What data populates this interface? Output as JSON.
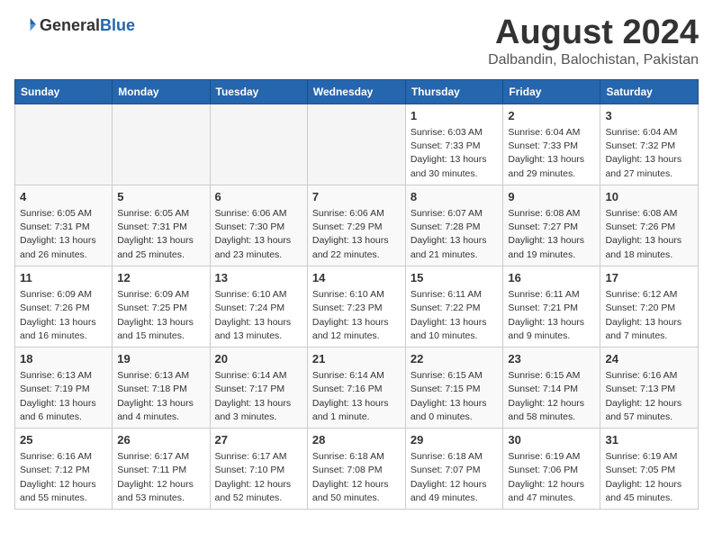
{
  "header": {
    "logo_general": "General",
    "logo_blue": "Blue",
    "month_title": "August 2024",
    "subtitle": "Dalbandin, Balochistan, Pakistan"
  },
  "weekdays": [
    "Sunday",
    "Monday",
    "Tuesday",
    "Wednesday",
    "Thursday",
    "Friday",
    "Saturday"
  ],
  "weeks": [
    [
      {
        "day": "",
        "sunrise": "",
        "sunset": "",
        "daylight": "",
        "empty": true
      },
      {
        "day": "",
        "sunrise": "",
        "sunset": "",
        "daylight": "",
        "empty": true
      },
      {
        "day": "",
        "sunrise": "",
        "sunset": "",
        "daylight": "",
        "empty": true
      },
      {
        "day": "",
        "sunrise": "",
        "sunset": "",
        "daylight": "",
        "empty": true
      },
      {
        "day": "1",
        "sunrise": "Sunrise: 6:03 AM",
        "sunset": "Sunset: 7:33 PM",
        "daylight": "Daylight: 13 hours and 30 minutes.",
        "empty": false
      },
      {
        "day": "2",
        "sunrise": "Sunrise: 6:04 AM",
        "sunset": "Sunset: 7:33 PM",
        "daylight": "Daylight: 13 hours and 29 minutes.",
        "empty": false
      },
      {
        "day": "3",
        "sunrise": "Sunrise: 6:04 AM",
        "sunset": "Sunset: 7:32 PM",
        "daylight": "Daylight: 13 hours and 27 minutes.",
        "empty": false
      }
    ],
    [
      {
        "day": "4",
        "sunrise": "Sunrise: 6:05 AM",
        "sunset": "Sunset: 7:31 PM",
        "daylight": "Daylight: 13 hours and 26 minutes.",
        "empty": false
      },
      {
        "day": "5",
        "sunrise": "Sunrise: 6:05 AM",
        "sunset": "Sunset: 7:31 PM",
        "daylight": "Daylight: 13 hours and 25 minutes.",
        "empty": false
      },
      {
        "day": "6",
        "sunrise": "Sunrise: 6:06 AM",
        "sunset": "Sunset: 7:30 PM",
        "daylight": "Daylight: 13 hours and 23 minutes.",
        "empty": false
      },
      {
        "day": "7",
        "sunrise": "Sunrise: 6:06 AM",
        "sunset": "Sunset: 7:29 PM",
        "daylight": "Daylight: 13 hours and 22 minutes.",
        "empty": false
      },
      {
        "day": "8",
        "sunrise": "Sunrise: 6:07 AM",
        "sunset": "Sunset: 7:28 PM",
        "daylight": "Daylight: 13 hours and 21 minutes.",
        "empty": false
      },
      {
        "day": "9",
        "sunrise": "Sunrise: 6:08 AM",
        "sunset": "Sunset: 7:27 PM",
        "daylight": "Daylight: 13 hours and 19 minutes.",
        "empty": false
      },
      {
        "day": "10",
        "sunrise": "Sunrise: 6:08 AM",
        "sunset": "Sunset: 7:26 PM",
        "daylight": "Daylight: 13 hours and 18 minutes.",
        "empty": false
      }
    ],
    [
      {
        "day": "11",
        "sunrise": "Sunrise: 6:09 AM",
        "sunset": "Sunset: 7:26 PM",
        "daylight": "Daylight: 13 hours and 16 minutes.",
        "empty": false
      },
      {
        "day": "12",
        "sunrise": "Sunrise: 6:09 AM",
        "sunset": "Sunset: 7:25 PM",
        "daylight": "Daylight: 13 hours and 15 minutes.",
        "empty": false
      },
      {
        "day": "13",
        "sunrise": "Sunrise: 6:10 AM",
        "sunset": "Sunset: 7:24 PM",
        "daylight": "Daylight: 13 hours and 13 minutes.",
        "empty": false
      },
      {
        "day": "14",
        "sunrise": "Sunrise: 6:10 AM",
        "sunset": "Sunset: 7:23 PM",
        "daylight": "Daylight: 13 hours and 12 minutes.",
        "empty": false
      },
      {
        "day": "15",
        "sunrise": "Sunrise: 6:11 AM",
        "sunset": "Sunset: 7:22 PM",
        "daylight": "Daylight: 13 hours and 10 minutes.",
        "empty": false
      },
      {
        "day": "16",
        "sunrise": "Sunrise: 6:11 AM",
        "sunset": "Sunset: 7:21 PM",
        "daylight": "Daylight: 13 hours and 9 minutes.",
        "empty": false
      },
      {
        "day": "17",
        "sunrise": "Sunrise: 6:12 AM",
        "sunset": "Sunset: 7:20 PM",
        "daylight": "Daylight: 13 hours and 7 minutes.",
        "empty": false
      }
    ],
    [
      {
        "day": "18",
        "sunrise": "Sunrise: 6:13 AM",
        "sunset": "Sunset: 7:19 PM",
        "daylight": "Daylight: 13 hours and 6 minutes.",
        "empty": false
      },
      {
        "day": "19",
        "sunrise": "Sunrise: 6:13 AM",
        "sunset": "Sunset: 7:18 PM",
        "daylight": "Daylight: 13 hours and 4 minutes.",
        "empty": false
      },
      {
        "day": "20",
        "sunrise": "Sunrise: 6:14 AM",
        "sunset": "Sunset: 7:17 PM",
        "daylight": "Daylight: 13 hours and 3 minutes.",
        "empty": false
      },
      {
        "day": "21",
        "sunrise": "Sunrise: 6:14 AM",
        "sunset": "Sunset: 7:16 PM",
        "daylight": "Daylight: 13 hours and 1 minute.",
        "empty": false
      },
      {
        "day": "22",
        "sunrise": "Sunrise: 6:15 AM",
        "sunset": "Sunset: 7:15 PM",
        "daylight": "Daylight: 13 hours and 0 minutes.",
        "empty": false
      },
      {
        "day": "23",
        "sunrise": "Sunrise: 6:15 AM",
        "sunset": "Sunset: 7:14 PM",
        "daylight": "Daylight: 12 hours and 58 minutes.",
        "empty": false
      },
      {
        "day": "24",
        "sunrise": "Sunrise: 6:16 AM",
        "sunset": "Sunset: 7:13 PM",
        "daylight": "Daylight: 12 hours and 57 minutes.",
        "empty": false
      }
    ],
    [
      {
        "day": "25",
        "sunrise": "Sunrise: 6:16 AM",
        "sunset": "Sunset: 7:12 PM",
        "daylight": "Daylight: 12 hours and 55 minutes.",
        "empty": false
      },
      {
        "day": "26",
        "sunrise": "Sunrise: 6:17 AM",
        "sunset": "Sunset: 7:11 PM",
        "daylight": "Daylight: 12 hours and 53 minutes.",
        "empty": false
      },
      {
        "day": "27",
        "sunrise": "Sunrise: 6:17 AM",
        "sunset": "Sunset: 7:10 PM",
        "daylight": "Daylight: 12 hours and 52 minutes.",
        "empty": false
      },
      {
        "day": "28",
        "sunrise": "Sunrise: 6:18 AM",
        "sunset": "Sunset: 7:08 PM",
        "daylight": "Daylight: 12 hours and 50 minutes.",
        "empty": false
      },
      {
        "day": "29",
        "sunrise": "Sunrise: 6:18 AM",
        "sunset": "Sunset: 7:07 PM",
        "daylight": "Daylight: 12 hours and 49 minutes.",
        "empty": false
      },
      {
        "day": "30",
        "sunrise": "Sunrise: 6:19 AM",
        "sunset": "Sunset: 7:06 PM",
        "daylight": "Daylight: 12 hours and 47 minutes.",
        "empty": false
      },
      {
        "day": "31",
        "sunrise": "Sunrise: 6:19 AM",
        "sunset": "Sunset: 7:05 PM",
        "daylight": "Daylight: 12 hours and 45 minutes.",
        "empty": false
      }
    ]
  ]
}
